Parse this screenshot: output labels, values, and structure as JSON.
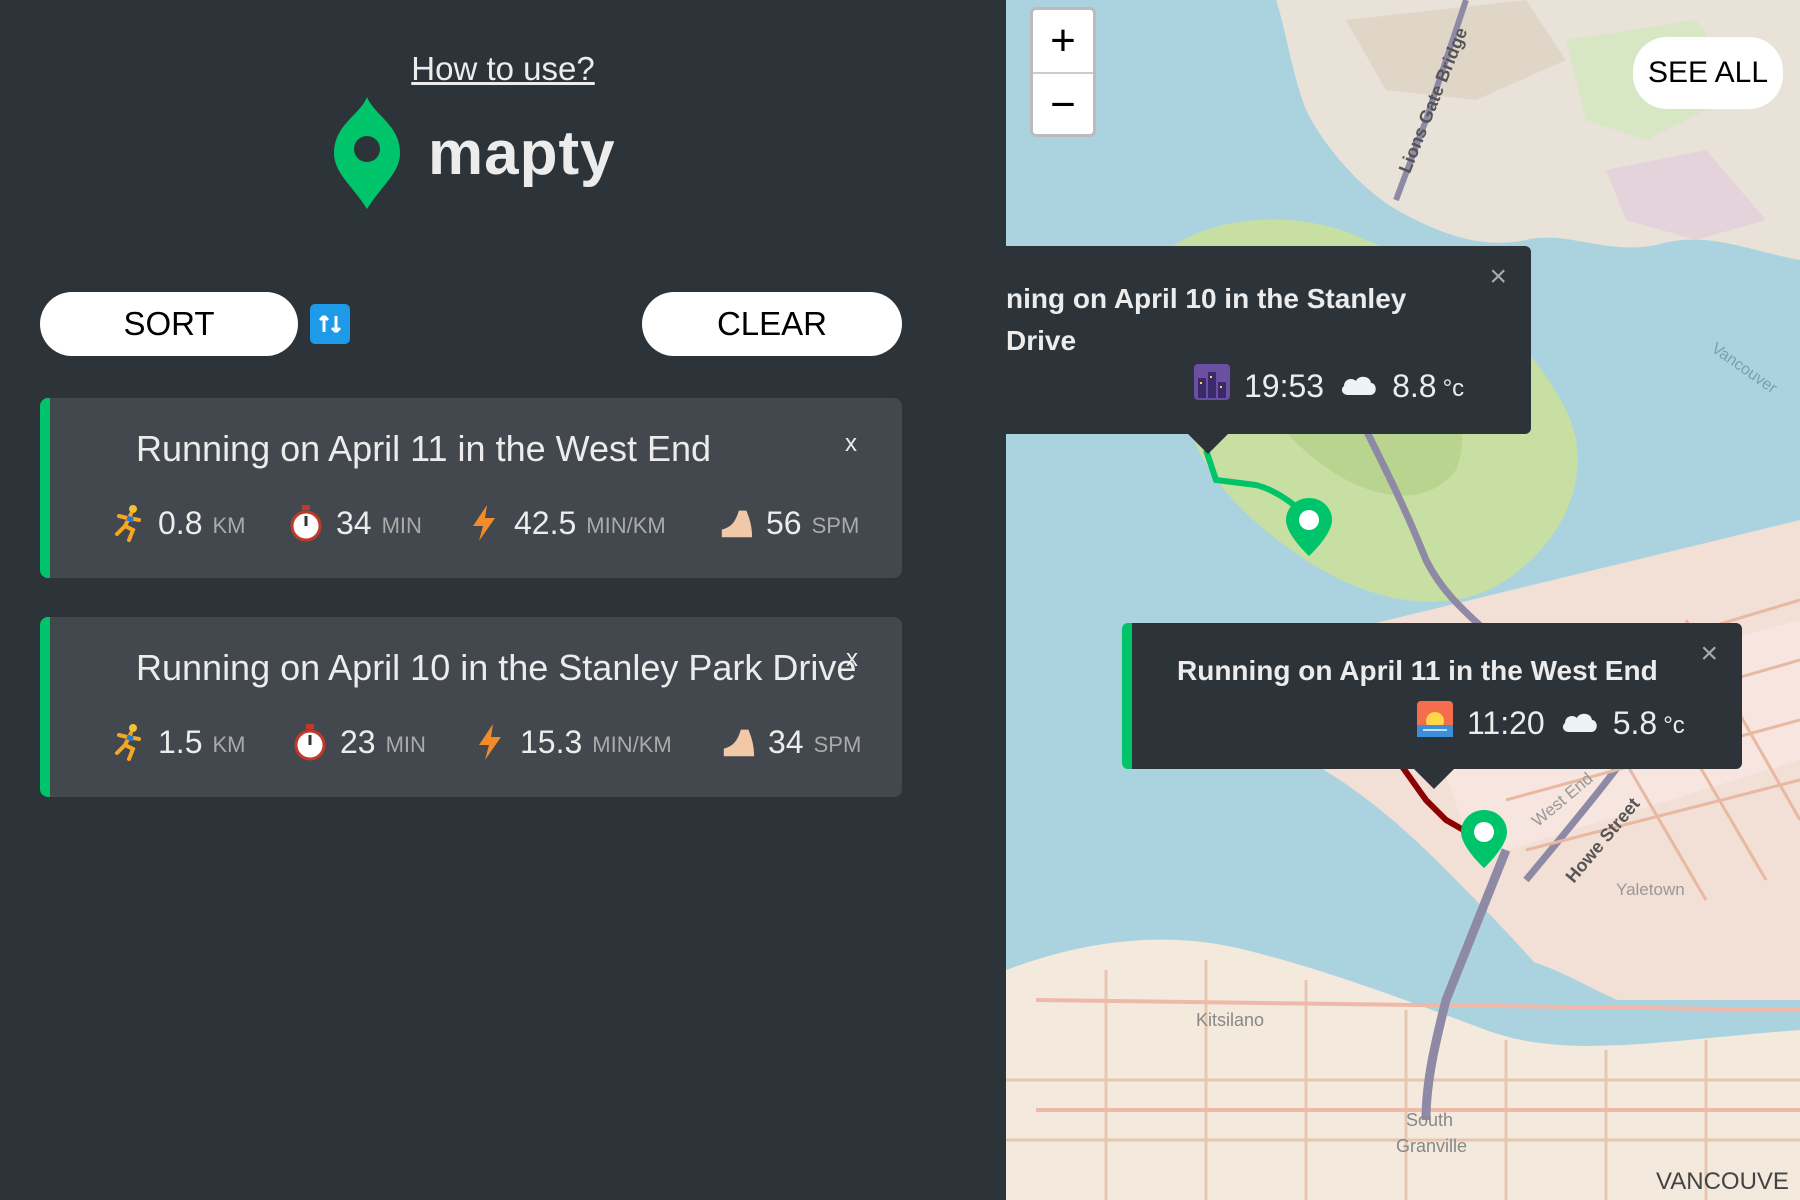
{
  "header": {
    "how_to_use": "How to use?",
    "brand_name": "mapty",
    "brand_color": "#00c46a"
  },
  "controls": {
    "sort_label": "SORT",
    "clear_label": "CLEAR",
    "swap_icon_color": "#1e9be8"
  },
  "workouts": [
    {
      "title": "Running on April 11 in the West End",
      "delete": "x",
      "distance": "0.8",
      "distance_unit": "KM",
      "duration": "34",
      "duration_unit": "MIN",
      "pace": "42.5",
      "pace_unit": "MIN/KM",
      "cadence": "56",
      "cadence_unit": "SPM"
    },
    {
      "title": "Running on April 10 in the Stanley Park Drive",
      "delete": "x",
      "distance": "1.5",
      "distance_unit": "KM",
      "duration": "23",
      "duration_unit": "MIN",
      "pace": "15.3",
      "pace_unit": "MIN/KM",
      "cadence": "34",
      "cadence_unit": "SPM"
    }
  ],
  "map": {
    "zoom_in": "+",
    "zoom_out": "−",
    "see_all": "SEE ALL",
    "labels": {
      "lions_gate": "Lions Gate Bridge",
      "vancouver_harbour": "Vancouver",
      "west_end": "West End",
      "howe_street": "Howe Street",
      "yaletown": "Yaletown",
      "kitsilano": "Kitsilano",
      "south": "South",
      "granville": "Granville",
      "vancouver": "VANCOUVE"
    },
    "popups": [
      {
        "text": "ning on April 10 in the Stanley Drive",
        "time": "19:53",
        "temp": "8.8",
        "unit": "°c",
        "close": "×"
      },
      {
        "text": "Running on April 11 in the West End",
        "time": "11:20",
        "temp": "5.8",
        "unit": "°c",
        "close": "×"
      }
    ]
  }
}
